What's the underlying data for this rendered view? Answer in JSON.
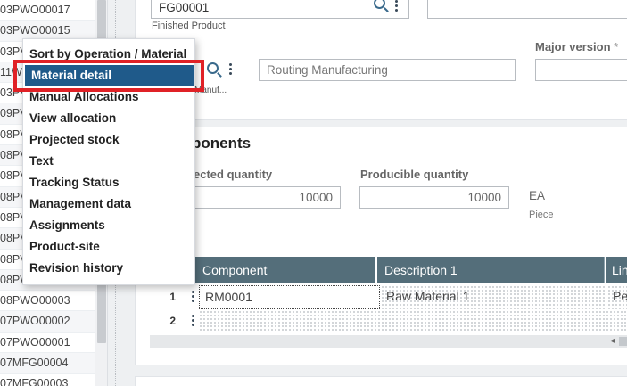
{
  "left_list": {
    "items": [
      "03PWO00017",
      "03PWO00015",
      "03PV",
      "11W",
      "03PV",
      "09PV",
      "08PV",
      "08PV",
      "08PV",
      "08PV",
      "08PV",
      "08PV",
      "08PV",
      "08PWO00004",
      "08PWO00003",
      "07PWO00002",
      "07PWO00001",
      "07MFG00004",
      "07MFG00003"
    ]
  },
  "header": {
    "product_value": "FG00001",
    "product_label": "Finished Product",
    "routing_code_label": "Manuf...",
    "routing_desc": "Routing Manufacturing",
    "major_version_label": "Major version",
    "required_star": "*"
  },
  "components": {
    "title": "ponents",
    "expected_qty_label": "ected quantity",
    "expected_qty_value": "10000",
    "producible_qty_label": "Producible quantity",
    "producible_qty_value": "10000",
    "unit": "EA",
    "unit_desc": "Piece"
  },
  "grid": {
    "columns": [
      "Component",
      "Description 1",
      "Lin"
    ],
    "rows": [
      {
        "num": "1",
        "component": "RM0001",
        "description": "Raw Material 1",
        "line": "Pe"
      },
      {
        "num": "2",
        "component": "",
        "description": "",
        "line": ""
      }
    ]
  },
  "context_menu": {
    "items": [
      "Sort by Operation / Material",
      "Material detail",
      "Manual Allocations",
      "View allocation",
      "Projected stock",
      "Text",
      "Tracking Status",
      "Management data",
      "Assignments",
      "Product-site",
      "Revision history"
    ],
    "highlighted": "Material detail",
    "highlight_color": "#1f5a8a",
    "annotation_color": "#e02126"
  }
}
